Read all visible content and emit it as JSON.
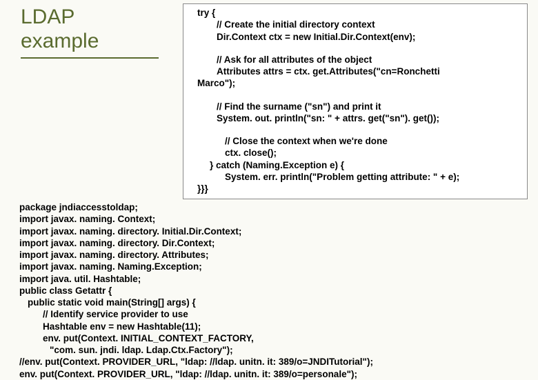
{
  "title_line1": "LDAP",
  "title_line2": "example",
  "codebox": {
    "l1": "try {",
    "l2": "// Create the initial directory context",
    "l3": "Dir.Context ctx = new Initial.Dir.Context(env);",
    "l4": "// Ask for all attributes of the object",
    "l5": "Attributes attrs = ctx. get.Attributes(\"cn=Ronchetti",
    "l5b": "Marco\");",
    "l6": "// Find the surname (\"sn\") and print it",
    "l7": "System. out. println(\"sn: \" + attrs. get(\"sn\"). get());",
    "l8": "// Close the context when we're done",
    "l9": "ctx. close();",
    "l10": "} catch (Naming.Exception e) {",
    "l11": "System. err. println(\"Problem getting attribute: \" + e);",
    "l12": "}}}"
  },
  "main": {
    "l1": "package jndiaccesstoldap;",
    "l2": "import javax. naming. Context;",
    "l3": "import javax. naming. directory. Initial.Dir.Context;",
    "l4": "import javax. naming. directory. Dir.Context;",
    "l5": "import javax. naming. directory. Attributes;",
    "l6": "import javax. naming. Naming.Exception;",
    "l7": "import java. util. Hashtable;",
    "l8": "public class Getattr {",
    "l9": "public static void main(String[] args) {",
    "l10": "// Identify service provider to use",
    "l11": "Hashtable env = new Hashtable(11);",
    "l12": "env. put(Context. INITIAL_CONTEXT_FACTORY,",
    "l13": "\"com. sun. jndi. ldap. Ldap.Ctx.Factory\");",
    "l14": "//env. put(Context. PROVIDER_URL, \"ldap: //ldap. unitn. it: 389/o=JNDITutorial\");",
    "l15": "env. put(Context. PROVIDER_URL, \"ldap: //ldap. unitn. it: 389/o=personale\");"
  }
}
